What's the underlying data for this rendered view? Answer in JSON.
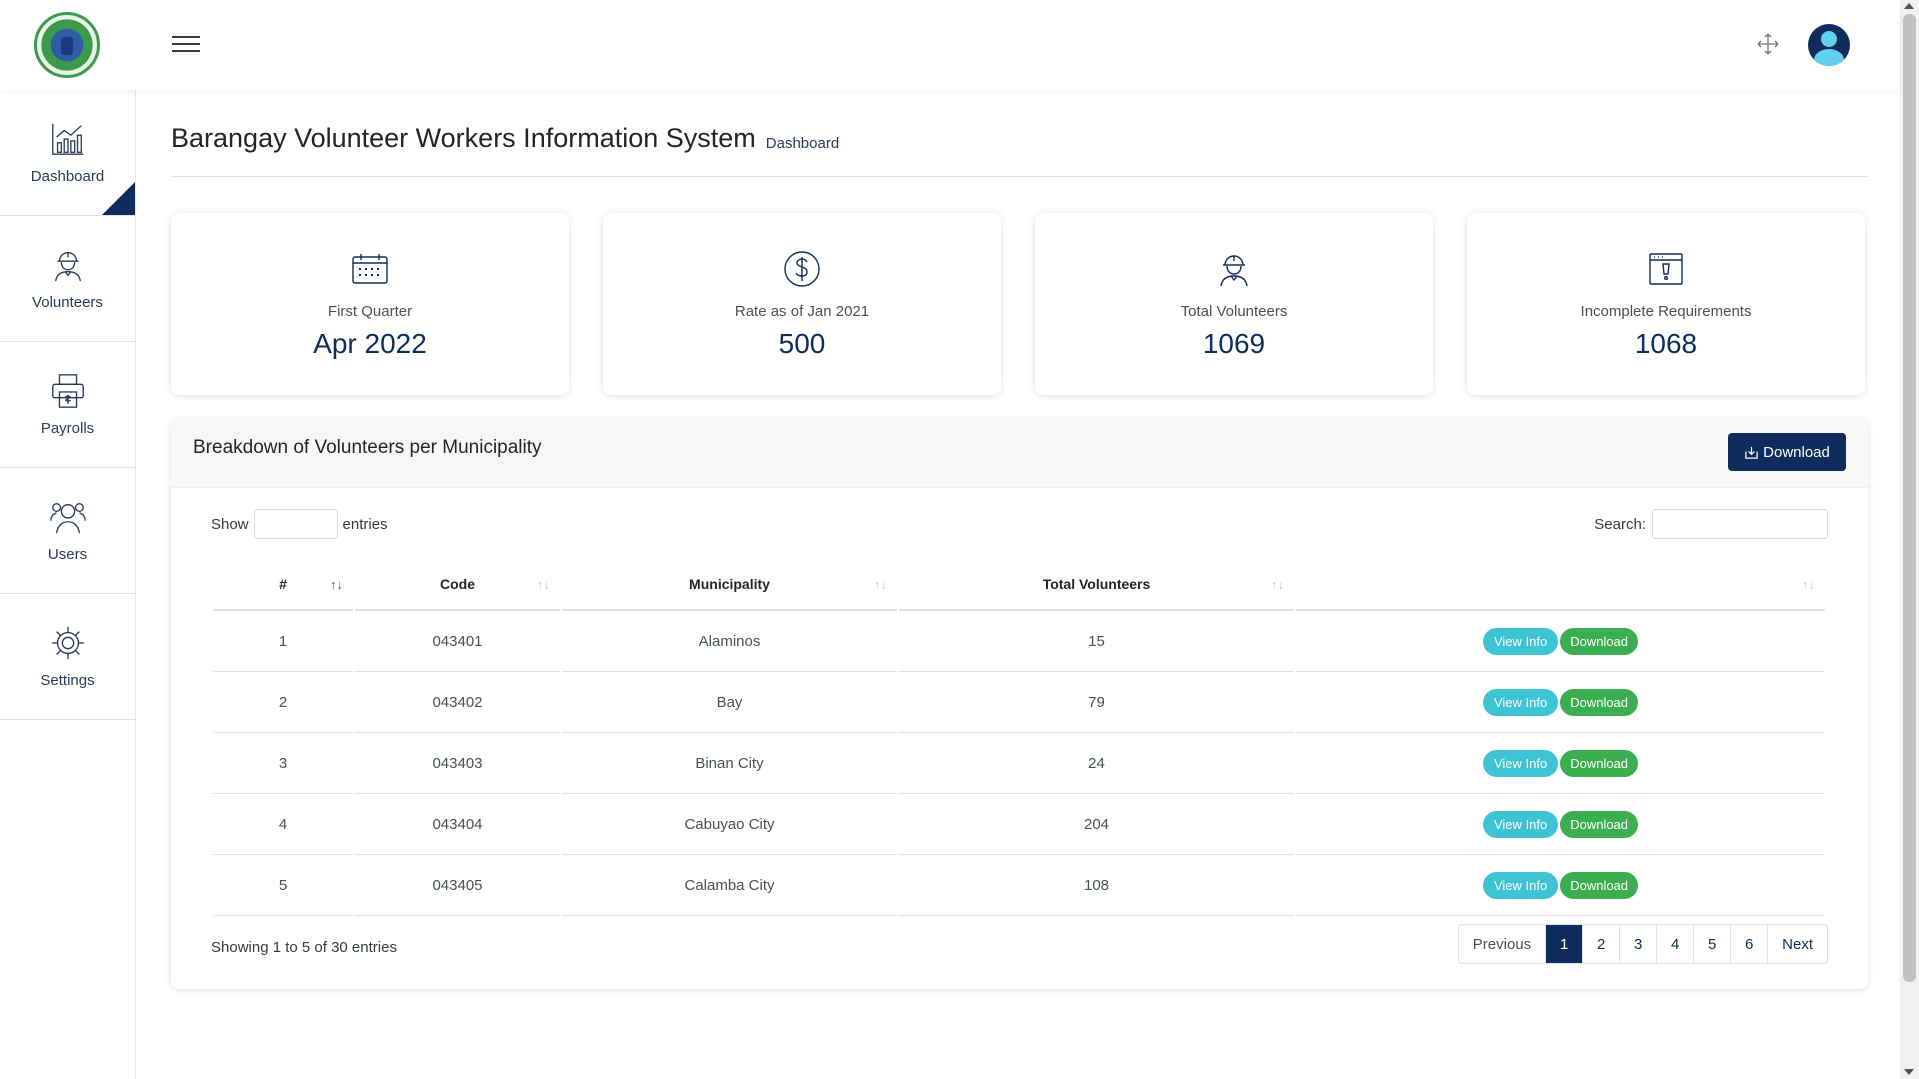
{
  "header": {
    "menu_icon": "hamburger-icon",
    "expand_icon": "expand-arrows-icon",
    "avatar_icon": "user-avatar-icon"
  },
  "sidebar": {
    "items": [
      {
        "label": "Dashboard",
        "icon": "chart-icon"
      },
      {
        "label": "Volunteers",
        "icon": "worker-icon"
      },
      {
        "label": "Payrolls",
        "icon": "printer-payroll-icon"
      },
      {
        "label": "Users",
        "icon": "users-icon"
      },
      {
        "label": "Settings",
        "icon": "gear-icon"
      }
    ]
  },
  "page": {
    "title": "Barangay Volunteer Workers Information System",
    "subtitle": "Dashboard"
  },
  "cards": [
    {
      "label": "First Quarter",
      "value": "Apr 2022",
      "icon": "calendar-icon"
    },
    {
      "label": "Rate as of Jan 2021",
      "value": "500",
      "icon": "dollar-icon"
    },
    {
      "label": "Total Volunteers",
      "value": "1069",
      "icon": "worker-icon"
    },
    {
      "label": "Incomplete Requirements",
      "value": "1068",
      "icon": "alert-window-icon"
    }
  ],
  "panel": {
    "title": "Breakdown of Volunteers per Municipality",
    "download_label": "Download",
    "show_label": "Show",
    "entries_label": "entries",
    "search_label": "Search:",
    "columns": [
      "#",
      "Code",
      "Municipality",
      "Total Volunteers",
      ""
    ],
    "rows": [
      {
        "num": "1",
        "code": "043401",
        "municipality": "Alaminos",
        "total": "15"
      },
      {
        "num": "2",
        "code": "043402",
        "municipality": "Bay",
        "total": "79"
      },
      {
        "num": "3",
        "code": "043403",
        "municipality": "Binan City",
        "total": "24"
      },
      {
        "num": "4",
        "code": "043404",
        "municipality": "Cabuyao City",
        "total": "204"
      },
      {
        "num": "5",
        "code": "043405",
        "municipality": "Calamba City",
        "total": "108"
      }
    ],
    "view_label": "View Info",
    "row_download_label": "Download",
    "info": "Showing 1 to 5 of 30 entries",
    "pagination": {
      "previous": "Previous",
      "next": "Next",
      "pages": [
        "1",
        "2",
        "3",
        "4",
        "5",
        "6"
      ],
      "active": "1"
    }
  },
  "colors": {
    "primary": "#0f2d5c",
    "info": "#3ec3d5",
    "success": "#3bae4f"
  }
}
